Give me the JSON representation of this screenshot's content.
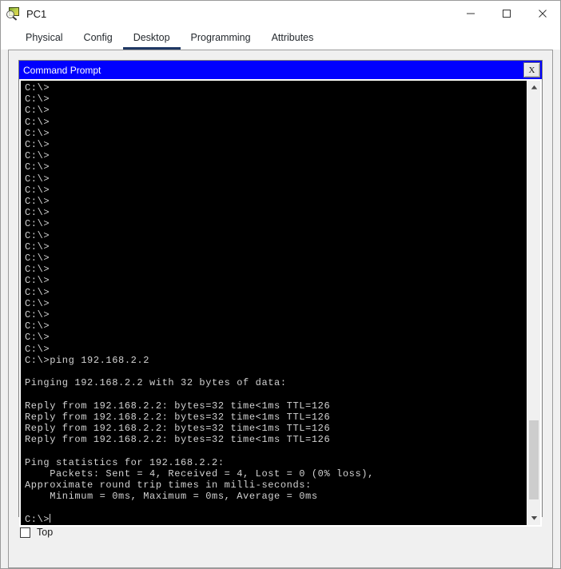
{
  "window": {
    "title": "PC1",
    "icon": "packet-tracer-pc-icon",
    "controls": {
      "minimize": "minimize-icon",
      "maximize": "maximize-icon",
      "close": "close-icon"
    }
  },
  "tabs": [
    {
      "label": "Physical",
      "active": false
    },
    {
      "label": "Config",
      "active": false
    },
    {
      "label": "Desktop",
      "active": true
    },
    {
      "label": "Programming",
      "active": false
    },
    {
      "label": "Attributes",
      "active": false
    }
  ],
  "command_prompt": {
    "title": "Command Prompt",
    "close_label": "X",
    "title_bg": "#0000ff",
    "terminal_bg": "#000000",
    "terminal_fg": "#d2d2d2",
    "lines": [
      "C:\\>",
      "C:\\>",
      "C:\\>",
      "C:\\>",
      "C:\\>",
      "C:\\>",
      "C:\\>",
      "C:\\>",
      "C:\\>",
      "C:\\>",
      "C:\\>",
      "C:\\>",
      "C:\\>",
      "C:\\>",
      "C:\\>",
      "C:\\>",
      "C:\\>",
      "C:\\>",
      "C:\\>",
      "C:\\>",
      "C:\\>",
      "C:\\>",
      "C:\\>",
      "C:\\>",
      "C:\\>ping 192.168.2.2",
      "",
      "Pinging 192.168.2.2 with 32 bytes of data:",
      "",
      "Reply from 192.168.2.2: bytes=32 time<1ms TTL=126",
      "Reply from 192.168.2.2: bytes=32 time<1ms TTL=126",
      "Reply from 192.168.2.2: bytes=32 time<1ms TTL=126",
      "Reply from 192.168.2.2: bytes=32 time<1ms TTL=126",
      "",
      "Ping statistics for 192.168.2.2:",
      "    Packets: Sent = 4, Received = 4, Lost = 0 (0% loss),",
      "Approximate round trip times in milli-seconds:",
      "    Minimum = 0ms, Maximum = 0ms, Average = 0ms",
      ""
    ],
    "prompt_line": "C:\\>",
    "scrollbar": {
      "up_arrow": "chevron-up-icon",
      "down_arrow": "chevron-down-icon",
      "thumb_top_pct": 78,
      "thumb_height_pct": 19
    }
  },
  "footer": {
    "top_checkbox_label": "Top",
    "top_checkbox_checked": false
  }
}
